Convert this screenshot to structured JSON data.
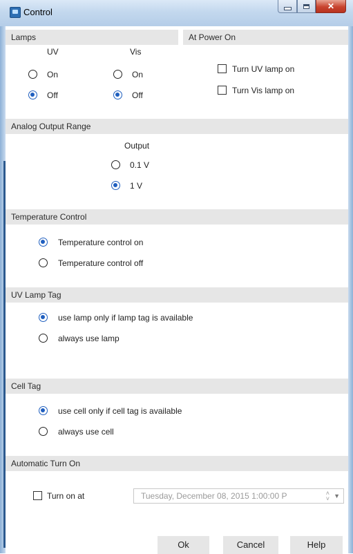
{
  "window": {
    "title": "Control"
  },
  "lamps": {
    "header": "Lamps",
    "uv": {
      "label": "UV",
      "options": [
        "On",
        "Off"
      ],
      "selected": "Off"
    },
    "vis": {
      "label": "Vis",
      "options": [
        "On",
        "Off"
      ],
      "selected": "Off"
    }
  },
  "power_on": {
    "header": "At Power On",
    "uv_label": "Turn UV lamp on",
    "uv_checked": false,
    "vis_label": "Turn Vis lamp on",
    "vis_checked": false
  },
  "analog": {
    "header": "Analog Output Range",
    "output_label": "Output",
    "options": [
      "0.1 V",
      "1 V"
    ],
    "selected": "1 V"
  },
  "temperature": {
    "header": "Temperature Control",
    "options": [
      "Temperature control on",
      "Temperature control off"
    ],
    "selected": "Temperature control on"
  },
  "uv_lamp_tag": {
    "header": "UV Lamp Tag",
    "options": [
      "use lamp only if lamp tag is available",
      "always use lamp"
    ],
    "selected": "use lamp only if lamp tag is available"
  },
  "cell_tag": {
    "header": "Cell Tag",
    "options": [
      "use cell only if cell tag is available",
      "always use cell"
    ],
    "selected": "use cell only if cell tag is available"
  },
  "auto_turn_on": {
    "header": "Automatic Turn On",
    "checkbox_label": "Turn on at",
    "checked": false,
    "datetime": "Tuesday, December 08, 2015  1:00:00 P"
  },
  "buttons": {
    "ok": "Ok",
    "cancel": "Cancel",
    "help": "Help"
  },
  "colors": {
    "accent": "#1f5fbf",
    "section_header": "#e6e6e6",
    "button": "#e6e6e6"
  }
}
